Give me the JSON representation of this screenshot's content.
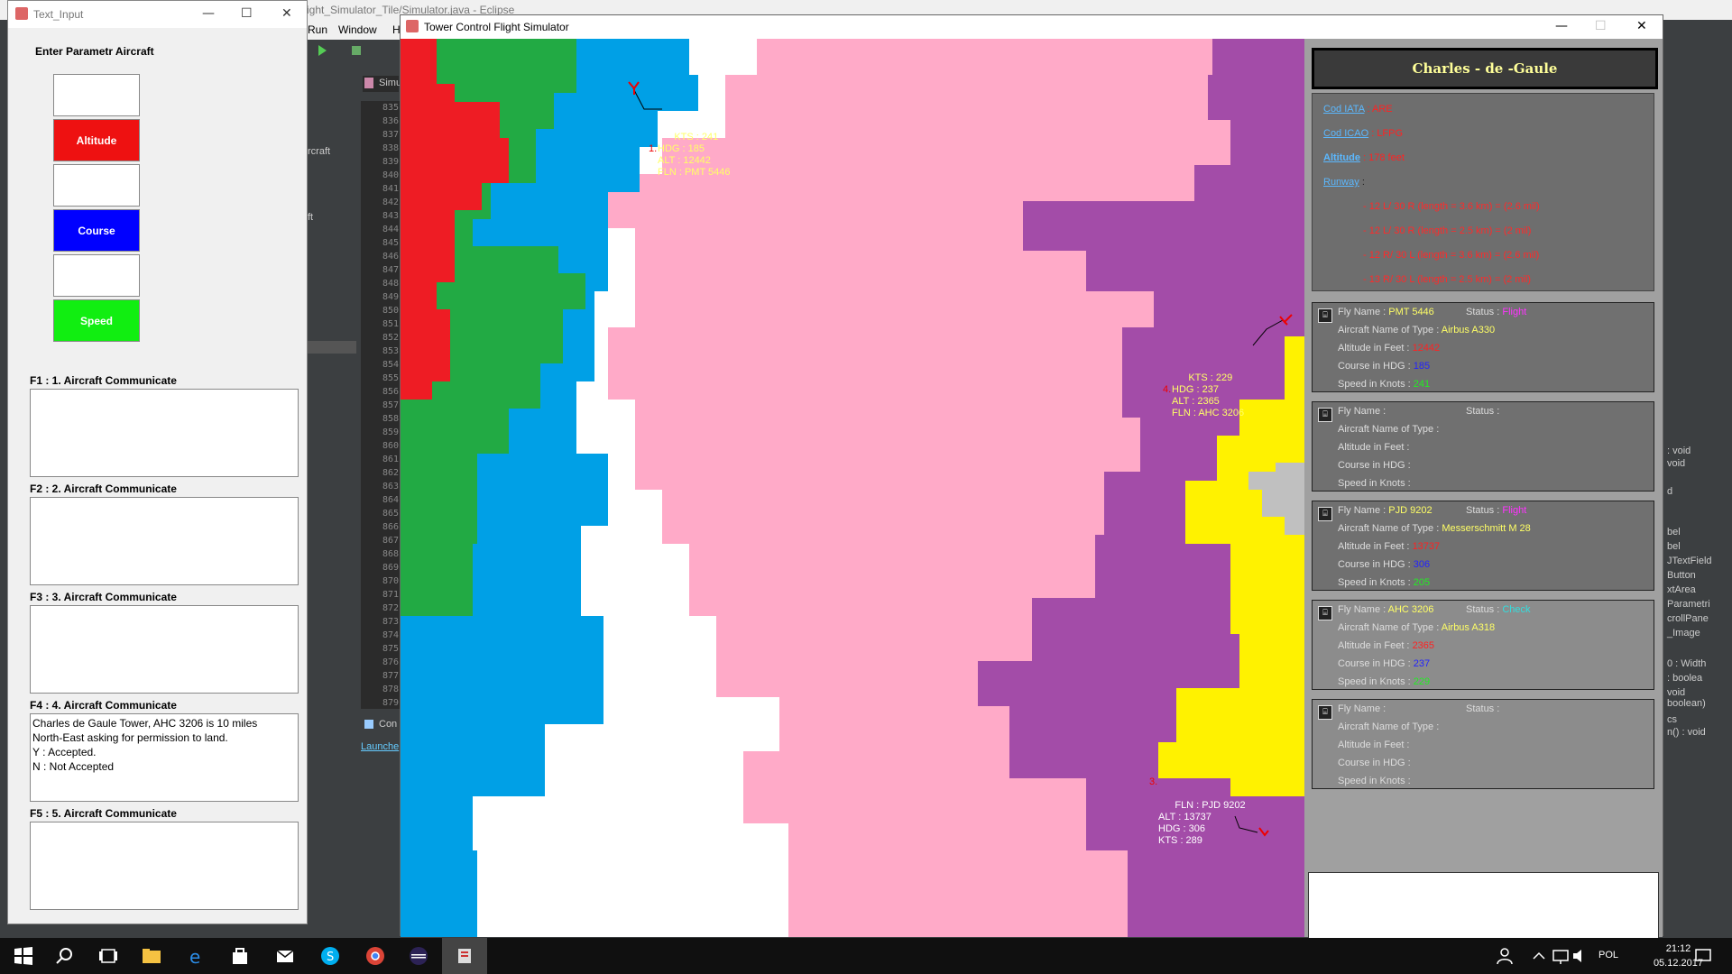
{
  "eclipse": {
    "title": "ight_Simulator_Tile/Simulator.java - Eclipse",
    "menu": [
      "Run",
      "Window",
      "H"
    ],
    "tab": "Simu",
    "console_tab": "Con",
    "launch_tab": "Launche",
    "left_fragments": [
      "rcraft",
      "ft"
    ],
    "line_numbers": [
      "835",
      "836",
      "837",
      "838",
      "839",
      "840",
      "841",
      "842",
      "843",
      "844",
      "845",
      "846",
      "847",
      "848",
      "849",
      "850",
      "851",
      "852",
      "853",
      "854",
      "855",
      "856",
      "857",
      "858",
      "859",
      "860",
      "861",
      "862",
      "863",
      "864",
      "865",
      "866",
      "867",
      "868",
      "869",
      "870",
      "871",
      "872",
      "873",
      "874",
      "875",
      "876",
      "877",
      "878",
      "879"
    ],
    "right_fragments": [
      ": void",
      "void",
      "d",
      "bel",
      "bel",
      "JTextField",
      "Button",
      "xtArea",
      "Parametri",
      "crollPane",
      "_Image",
      "0 : Width",
      ": boolea",
      "void",
      "boolean)",
      "cs",
      "n() : void"
    ]
  },
  "text_input": {
    "title": "Text_Input",
    "header": "Enter Parametr Aircraft",
    "fields": [
      {
        "label": "",
        "color": "#ffffff"
      },
      {
        "label": "Altitude",
        "color": "#ee1111"
      },
      {
        "label": "",
        "color": "#ffffff"
      },
      {
        "label": "Course",
        "color": "#0000ff"
      },
      {
        "label": "",
        "color": "#ffffff"
      },
      {
        "label": "Speed",
        "color": "#11ee11"
      }
    ],
    "communicates": [
      {
        "label": "F1 : 1. Aircraft Communicate",
        "text": ""
      },
      {
        "label": "F2 : 2. Aircraft Communicate",
        "text": ""
      },
      {
        "label": "F3 : 3. Aircraft Communicate",
        "text": ""
      },
      {
        "label": "F4 : 4. Aircraft Communicate",
        "text": "Charles de Gaule Tower, AHC 3206 is 10 miles\nNorth-East asking for permission to land.\n Y : Accepted.\n N : Not Accepted"
      },
      {
        "label": "F5 : 5. Aircraft Communicate",
        "text": ""
      }
    ]
  },
  "tower": {
    "title": "Tower Control Flight Simulator",
    "airport_name": "Charles - de -Gaule",
    "info": {
      "iata_label": "Cod IATA",
      "iata_value": ": ARE",
      "icao_label": "Cod ICAO",
      "icao_value": ": LFPG",
      "altitude_label": "Altitude",
      "altitude_value": ": 178 feet",
      "runway_label": "Runway",
      "runways": [
        "- 12 L/ 30 R (length = 3.6 km) = (2.6 mil)",
        "- 12 L/ 30 R (length = 2.5 km) = (2 mil)",
        "- 12 R/ 30 L (length = 3.6 km) = (2.6 mil)",
        "- 13 R/ 30 L (length = 2.5 km) = (2 mil)"
      ]
    },
    "flights": [
      {
        "fly_name_label": "Fly Name :",
        "fly_name": "PMT 5446",
        "status_label": "Status :",
        "status": "Flight",
        "status_color": "#ff33ff",
        "type_label": "Aircraft Name of Type :",
        "type": "Airbus A330",
        "alt_label": "Altitude in Feet :",
        "alt": "12442",
        "hdg_label": "Course in HDG :",
        "hdg": "185",
        "kts_label": "Speed in Knots :",
        "kts": "241"
      },
      {
        "fly_name_label": "Fly Name :",
        "fly_name": "",
        "status_label": "Status :",
        "status": "",
        "status_color": "#ff33ff",
        "type_label": "Aircraft Name of Type :",
        "type": "",
        "alt_label": "Altitude in Feet :",
        "alt": "",
        "hdg_label": "Course in HDG :",
        "hdg": "",
        "kts_label": "Speed in Knots :",
        "kts": ""
      },
      {
        "fly_name_label": "Fly Name :",
        "fly_name": "PJD 9202",
        "status_label": "Status :",
        "status": "Flight",
        "status_color": "#ff33ff",
        "type_label": "Aircraft Name of Type :",
        "type": "Messerschmitt M 28",
        "alt_label": "Altitude in Feet :",
        "alt": "13737",
        "hdg_label": "Course in HDG :",
        "hdg": "306",
        "kts_label": "Speed in Knots :",
        "kts": "205"
      },
      {
        "fly_name_label": "Fly Name :",
        "fly_name": "AHC 3206",
        "status_label": "Status :",
        "status": "Check",
        "status_color": "#33dddd",
        "type_label": "Aircraft Name of Type :",
        "type": "Airbus A318",
        "alt_label": "Altitude in Feet :",
        "alt": "2365",
        "hdg_label": "Course in HDG :",
        "hdg": "237",
        "kts_label": "Speed in Knots :",
        "kts": "229"
      },
      {
        "fly_name_label": "Fly Name :",
        "fly_name": "",
        "status_label": "Status :",
        "status": "",
        "status_color": "#ff33ff",
        "type_label": "Aircraft Name of Type :",
        "type": "",
        "alt_label": "Altitude in Feet :",
        "alt": "",
        "hdg_label": "Course in HDG :",
        "hdg": "",
        "kts_label": "Speed in Knots :",
        "kts": ""
      }
    ],
    "map_aircraft": [
      {
        "num": "1.",
        "label": "KTS : 241\nHDG : 185\nALT : 12442\nFLN : PMT 5446",
        "color": "#ffff66"
      },
      {
        "num": "4.",
        "label": "KTS : 229\nHDG : 237\nALT : 2365\nFLN : AHC 3206",
        "color": "#ffff66"
      },
      {
        "num": "3.",
        "label": "FLN : PJD 9202\nALT : 13737\nHDG : 306\nKTS : 289",
        "color": "#ffffff"
      }
    ],
    "colors": {
      "pink": "#ffaac8",
      "white": "#ffffff",
      "blue": "#00a0e6",
      "green": "#22aa44",
      "red": "#ee1c24",
      "purple": "#a34ca8",
      "yellow": "#fff200",
      "gray": "#c0c0c0"
    }
  },
  "taskbar": {
    "lang": "POL",
    "time": "21:12",
    "date": "05.12.2017"
  }
}
